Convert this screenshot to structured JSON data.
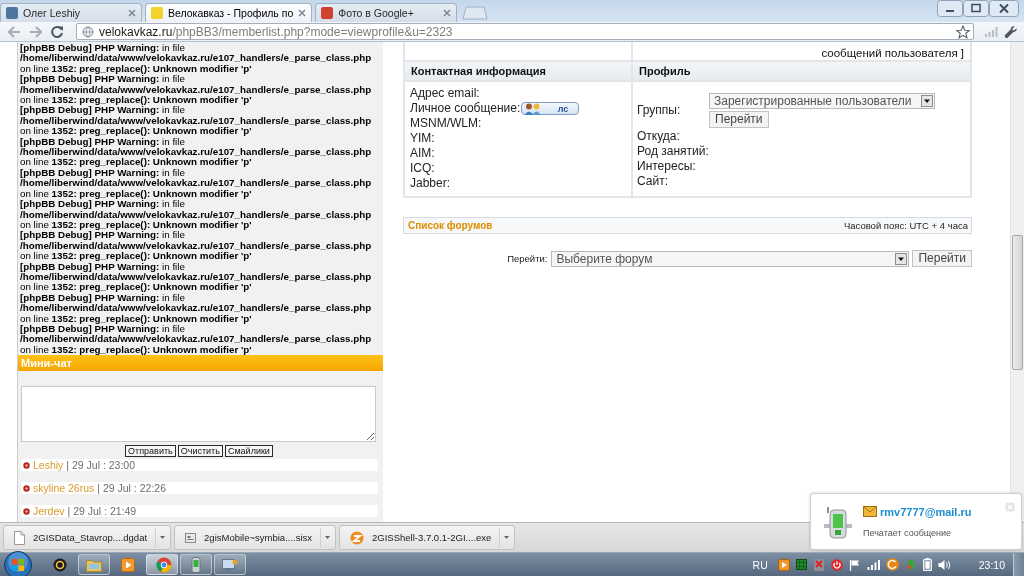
{
  "browser": {
    "tabs": [
      {
        "title": "Олег Leshiy",
        "selected": false,
        "color": "#4d76a1"
      },
      {
        "title": "Велокавказ - Профиль по",
        "selected": true,
        "color": "#f2d32b"
      },
      {
        "title": "Фото в Google+",
        "selected": false,
        "color": "#d2412f"
      }
    ],
    "address": {
      "host": "velokavkaz.ru",
      "path": "/phpBB3/memberlist.php?mode=viewprofile&u=2323"
    }
  },
  "debug_log": [
    {
      "heading": "**[phpBB Debug] PHP Warning:** in file",
      "path": "/home/liberwind/data/www/velokavkaz.ru/e107_handlers/e_parse_class.php",
      "detail": "on line **1352: preg_replace(): Unknown modifier 'p'**"
    },
    {
      "heading": "**[phpBB Debug] PHP Warning:** in file",
      "path": "/home/liberwind/data/www/velokavkaz.ru/e107_handlers/e_parse_class.php",
      "detail": "on line **1352: preg_replace(): Unknown modifier 'p'**"
    },
    {
      "heading": "**[phpBB Debug] PHP Warning:** in file",
      "path": "/home/liberwind/data/www/velokavkaz.ru/e107_handlers/e_parse_class.php",
      "detail": "on line **1352: preg_replace(): Unknown modifier 'p'**"
    },
    {
      "heading": "**[phpBB Debug] PHP Warning:** in file",
      "path": "/home/liberwind/data/www/velokavkaz.ru/e107_handlers/e_parse_class.php",
      "detail": "on line **1352: preg_replace(): Unknown modifier 'p'**"
    },
    {
      "heading": "**[phpBB Debug] PHP Warning:** in file",
      "path": "/home/liberwind/data/www/velokavkaz.ru/e107_handlers/e_parse_class.php",
      "detail": "on line **1352: preg_replace(): Unknown modifier 'p'**"
    },
    {
      "heading": "**[phpBB Debug] PHP Warning:** in file",
      "path": "/home/liberwind/data/www/velokavkaz.ru/e107_handlers/e_parse_class.php",
      "detail": "on line **1352: preg_replace(): Unknown modifier 'p'**"
    },
    {
      "heading": "**[phpBB Debug] PHP Warning:** in file",
      "path": "/home/liberwind/data/www/velokavkaz.ru/e107_handlers/e_parse_class.php",
      "detail": "on line **1352: preg_replace(): Unknown modifier 'p'**"
    },
    {
      "heading": "**[phpBB Debug] PHP Warning:** in file",
      "path": "/home/liberwind/data/www/velokavkaz.ru/e107_handlers/e_parse_class.php",
      "detail": "on line **1352: preg_replace(): Unknown modifier 'p'**"
    },
    {
      "heading": "**[phpBB Debug] PHP Warning:** in file",
      "path": "/home/liberwind/data/www/velokavkaz.ru/e107_handlers/e_parse_class.php",
      "detail": "on line **1352: preg_replace(): Unknown modifier 'p'**"
    },
    {
      "heading": "**[phpBB Debug] PHP Warning:** in file",
      "path": "/home/liberwind/data/www/velokavkaz.ru/e107_handlers/e_parse_class.php",
      "detail": "on line **1352: preg_replace(): Unknown modifier 'p'**"
    }
  ],
  "mini_chat": {
    "title": "Мини-чат",
    "buttons": [
      "Отправить",
      "Очистить",
      "Смайлики"
    ],
    "messages": [
      {
        "author": "Leshiy",
        "time": "| 29 Jul : 23:00"
      },
      {
        "author": "skyline 26rus",
        "time": "| 29 Jul : 22:26"
      },
      {
        "author": "Jerdev",
        "time": "| 29 Jul : 21:49"
      }
    ]
  },
  "profile": {
    "top_text": "сообщений пользователя ]",
    "contact": {
      "title": "Контактная информация",
      "fields": [
        {
          "label": "Адрес email:",
          "kind": "text"
        },
        {
          "label": "Личное сообщение:",
          "kind": "pm",
          "button": "лс"
        },
        {
          "label": "MSNM/WLM:",
          "kind": "text"
        },
        {
          "label": "YIM:",
          "kind": "text"
        },
        {
          "label": "AIM:",
          "kind": "text"
        },
        {
          "label": "ICQ:",
          "kind": "text"
        },
        {
          "label": "Jabber:",
          "kind": "text"
        }
      ]
    },
    "details": {
      "title": "Профиль",
      "fields": [
        {
          "label": "Группы:",
          "kind": "select",
          "value": "Зарегистрированные пользователи",
          "button": "Перейти"
        },
        {
          "label": "Откуда:",
          "kind": "text"
        },
        {
          "label": "Род занятий:",
          "kind": "text"
        },
        {
          "label": "Интересы:",
          "kind": "text"
        },
        {
          "label": "Сайт:",
          "kind": "text"
        }
      ]
    }
  },
  "nav_bar": {
    "link": "Список форумов",
    "timezone": "Часовой пояс: UTC + 4 часа"
  },
  "jump": {
    "label": "Перейти:",
    "value": "Выберите форум",
    "button": "Перейти"
  },
  "downloads": [
    {
      "name": "2GISData_Stavrop....dgdat",
      "kind": "document"
    },
    {
      "name": "2gisMobile~symbia....sisx",
      "kind": "package"
    },
    {
      "name": "2GISShell-3.7.0.1-2GI....exe",
      "kind": "installer"
    }
  ],
  "notification": {
    "sender": "rmv7777@mail.ru",
    "message": "Печатает сообщение"
  },
  "taskbar": {
    "apps": [
      {
        "kind": "disc",
        "running": false,
        "selected": false
      },
      {
        "kind": "folder",
        "running": true,
        "selected": false
      },
      {
        "kind": "media",
        "running": false,
        "selected": false
      },
      {
        "kind": "browser",
        "running": true,
        "selected": true
      },
      {
        "kind": "phone",
        "running": true,
        "selected": false
      },
      {
        "kind": "computer",
        "running": true,
        "selected": false
      }
    ],
    "language": "RU",
    "clock": "23:10"
  }
}
